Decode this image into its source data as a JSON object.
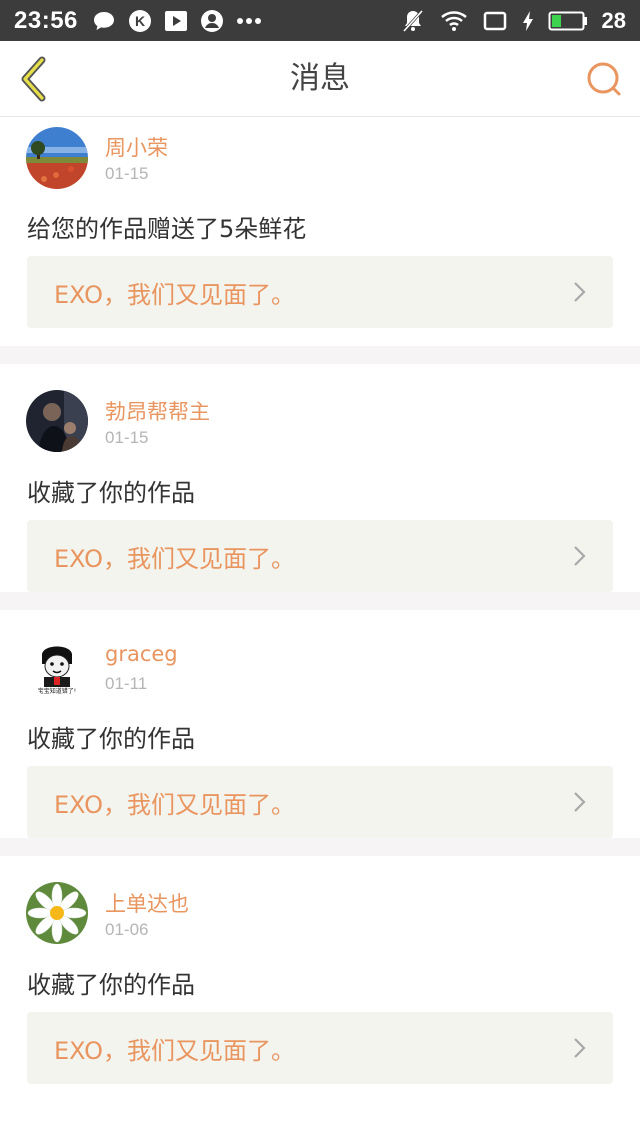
{
  "status_bar": {
    "time": "23:56",
    "battery": "28",
    "left_icons": [
      "chat-bubble-icon",
      "k-app-icon",
      "play-icon",
      "person-icon",
      "more-dots-icon"
    ],
    "right_icons": [
      "mute-bell-icon",
      "wifi-icon",
      "screen-icon",
      "charging-icon",
      "battery-icon"
    ]
  },
  "header": {
    "title": "消息",
    "back_icon": "chevron-left-icon",
    "search_icon": "search-icon",
    "accent_color": "#e9955f"
  },
  "messages": [
    {
      "username": "周小荣",
      "date": "01-15",
      "action": "给您的作品赠送了5朵鲜花",
      "work_title": "EXO，我们又见面了。",
      "avatar": "field-tree-avatar"
    },
    {
      "username": "勃昂帮帮主",
      "date": "01-15",
      "action": "收藏了你的作品",
      "work_title": "EXO，我们又见面了。",
      "avatar": "dark-photo-avatar"
    },
    {
      "username": "graceg",
      "date": "01-11",
      "action": "收藏了你的作品",
      "work_title": "EXO，我们又见面了。",
      "avatar": "meme-avatar",
      "avatar_caption": "宝宝知道错了!"
    },
    {
      "username": "上单达也",
      "date": "01-06",
      "action": "收藏了你的作品",
      "work_title": "EXO，我们又见面了。",
      "avatar": "daisy-avatar"
    }
  ]
}
